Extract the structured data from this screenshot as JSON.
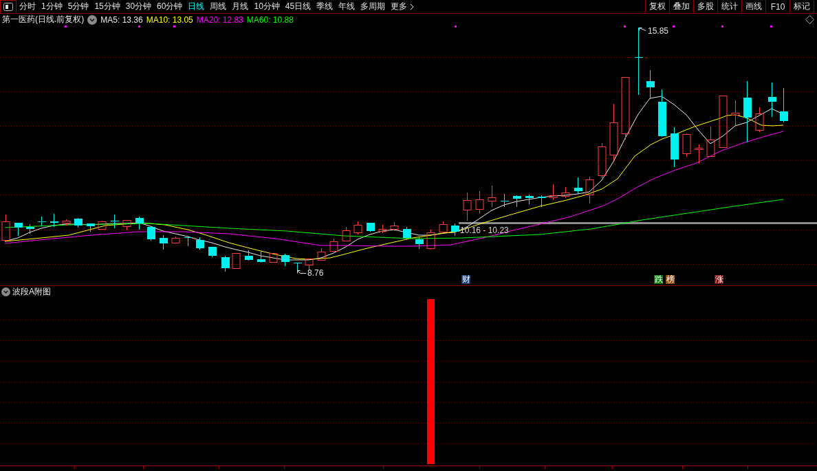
{
  "toolbar": {
    "periods": [
      {
        "label": "分时",
        "selected": false
      },
      {
        "label": "1分钟",
        "selected": false
      },
      {
        "label": "5分钟",
        "selected": false
      },
      {
        "label": "15分钟",
        "selected": false
      },
      {
        "label": "30分钟",
        "selected": false
      },
      {
        "label": "60分钟",
        "selected": false
      },
      {
        "label": "日线",
        "selected": true
      },
      {
        "label": "周线",
        "selected": false
      },
      {
        "label": "月线",
        "selected": false
      },
      {
        "label": "10分钟",
        "selected": false
      },
      {
        "label": "45日线",
        "selected": false
      },
      {
        "label": "季线",
        "selected": false
      },
      {
        "label": "年线",
        "selected": false
      },
      {
        "label": "多周期",
        "selected": false
      }
    ],
    "more": "更多",
    "buttons": [
      "复权",
      "叠加",
      "多股",
      "统计",
      "画线",
      "F10",
      "标记"
    ]
  },
  "chart_header": {
    "title": "第一医药(日线.前复权)",
    "indicators": [
      {
        "label": "MA5: 13.36",
        "color": "#e8e8e8"
      },
      {
        "label": "MA10: 13.05",
        "color": "#ffff00"
      },
      {
        "label": "MA20: 12.83",
        "color": "#ff00ff"
      },
      {
        "label": "MA60: 10.88",
        "color": "#00ff00"
      }
    ]
  },
  "main_chart": {
    "high_label": "15.85",
    "low_label": "8.76",
    "range_label": "10.16 - 10.23",
    "event_tags": [
      {
        "text": "财",
        "color": "#1c3c78"
      },
      {
        "text": "跌",
        "color": "#0b7d0b"
      },
      {
        "text": "榜",
        "color": "#8a4a14"
      },
      {
        "text": "涨",
        "color": "#7c0f0f"
      }
    ]
  },
  "sub_chart": {
    "title": "波段A附图"
  }
}
